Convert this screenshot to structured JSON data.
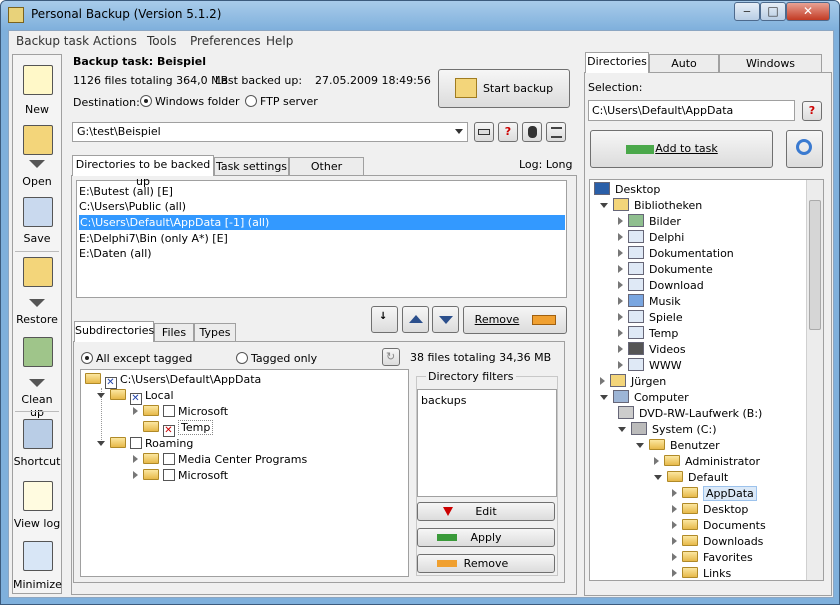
{
  "window": {
    "title": "Personal Backup (Version 5.1.2)",
    "minimize": "‒",
    "maximize": "□",
    "close": "✕"
  },
  "menu": [
    "Backup task",
    "Actions",
    "Tools",
    "Preferences",
    "Help"
  ],
  "toolbar": [
    {
      "label": "New",
      "icon": "new-task-icon"
    },
    {
      "label": "Open",
      "icon": "open-task-icon"
    },
    {
      "label": "Save",
      "icon": "save-task-icon"
    },
    {
      "label": "Restore",
      "icon": "restore-icon"
    },
    {
      "label": "Clean up",
      "icon": "cleanup-icon"
    },
    {
      "label": "Shortcut",
      "icon": "shortcut-icon"
    },
    {
      "label": "View log",
      "icon": "view-log-icon"
    },
    {
      "label": "Minimize",
      "icon": "minimize-icon"
    }
  ],
  "task": {
    "title": "Backup task: Beispiel",
    "files_info": "1126 files totaling 364,0 MB",
    "last_backup_label": "Last backed up:",
    "last_backup": "27.05.2009 18:49:56",
    "destination_label": "Destination:",
    "dest_windows": "Windows folder",
    "dest_ftp": "FTP server",
    "path": "G:\\test\\Beispiel",
    "start_button": "Start backup",
    "log_label": "Log: Long"
  },
  "main_tabs": [
    "Directories to be backed up",
    "Task settings",
    "Other options"
  ],
  "directories": [
    "E:\\Butest (all) [E]",
    "C:\\Users\\Public (all)",
    "C:\\Users\\Default\\AppData [-1] (all)",
    "E:\\Delphi7\\Bin (only A*) [E]",
    "E:\\Daten (all)"
  ],
  "remove_button": "Remove",
  "sub_tabs": [
    "Subdirectories",
    "Files",
    "Types"
  ],
  "sub_options": {
    "all_except": "All except tagged",
    "tagged_only": "Tagged only",
    "files_info": "38 files totaling 34,36 MB"
  },
  "subtree": [
    {
      "label": "C:\\Users\\Default\\AppData",
      "check": "x"
    },
    {
      "label": "Local",
      "check": "x"
    },
    {
      "label": "Microsoft",
      "check": ""
    },
    {
      "label": "Temp",
      "check": "x-red"
    },
    {
      "label": "Roaming",
      "check": ""
    },
    {
      "label": "Media Center Programs",
      "check": ""
    },
    {
      "label": "Microsoft",
      "check": ""
    }
  ],
  "filters": {
    "title": "Directory filters",
    "items": [
      "backups"
    ],
    "edit": "Edit",
    "apply": "Apply",
    "remove": "Remove"
  },
  "right_tabs": [
    "Directories",
    "Auto Backup",
    "Windows Scheduler"
  ],
  "selection": {
    "label": "Selection:",
    "value": "C:\\Users\\Default\\AppData",
    "add_button": "Add to task"
  },
  "dirtree": [
    "Desktop",
    "Bibliotheken",
    "Bilder",
    "Delphi",
    "Dokumentation",
    "Dokumente",
    "Download",
    "Musik",
    "Spiele",
    "Temp",
    "Videos",
    "WWW",
    "Jürgen",
    "Computer",
    "DVD-RW-Laufwerk (B:)",
    "System (C:)",
    "Benutzer",
    "Administrator",
    "Default",
    "AppData",
    "Desktop",
    "Documents",
    "Downloads",
    "Favorites",
    "Links"
  ],
  "colors": {
    "selection": "#3399ff",
    "title_gradient": "#7fb0dc"
  }
}
